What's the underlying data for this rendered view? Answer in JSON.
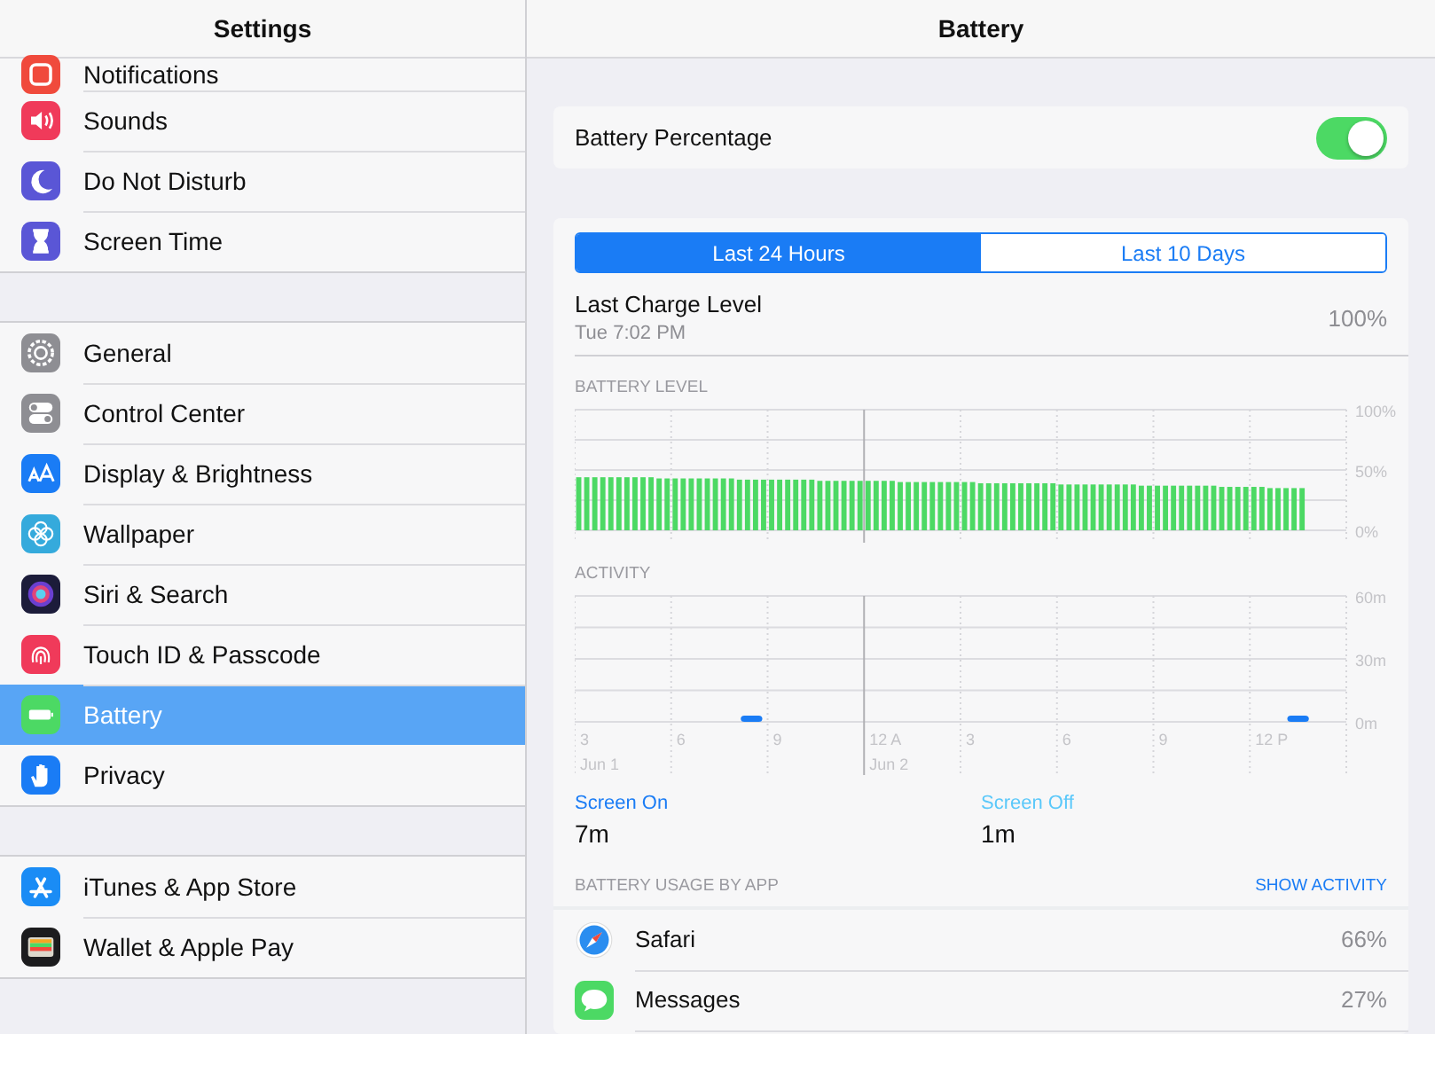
{
  "sidebar": {
    "title": "Settings",
    "groups": [
      {
        "items": [
          {
            "label": "Notifications",
            "selected": false
          },
          {
            "label": "Sounds",
            "selected": false
          },
          {
            "label": "Do Not Disturb",
            "selected": false
          },
          {
            "label": "Screen Time",
            "selected": false
          }
        ]
      },
      {
        "items": [
          {
            "label": "General",
            "selected": false
          },
          {
            "label": "Control Center",
            "selected": false
          },
          {
            "label": "Display & Brightness",
            "selected": false
          },
          {
            "label": "Wallpaper",
            "selected": false
          },
          {
            "label": "Siri & Search",
            "selected": false
          },
          {
            "label": "Touch ID & Passcode",
            "selected": false
          },
          {
            "label": "Battery",
            "selected": true
          },
          {
            "label": "Privacy",
            "selected": false
          }
        ]
      },
      {
        "items": [
          {
            "label": "iTunes & App Store",
            "selected": false
          },
          {
            "label": "Wallet & Apple Pay",
            "selected": false
          }
        ]
      }
    ]
  },
  "detail": {
    "title": "Battery",
    "percentage_row": {
      "label": "Battery Percentage",
      "on": true
    },
    "segments": [
      {
        "label": "Last 24 Hours",
        "selected": true
      },
      {
        "label": "Last 10 Days",
        "selected": false
      }
    ],
    "last_charge": {
      "label": "Last Charge Level",
      "time": "Tue 7:02 PM",
      "value": "100%"
    },
    "battery_level": {
      "label": "BATTERY LEVEL",
      "chart_data": {
        "type": "bar",
        "ylim": [
          0,
          100
        ],
        "yticks": [
          {
            "value": 0,
            "label": "0%"
          },
          {
            "value": 50,
            "label": "50%"
          },
          {
            "value": 100,
            "label": "100%"
          }
        ],
        "values": [
          44,
          44,
          44,
          44,
          44,
          44,
          44,
          44,
          44,
          44,
          43,
          43,
          43,
          43,
          43,
          43,
          43,
          43,
          43,
          43,
          42,
          42,
          42,
          42,
          42,
          42,
          42,
          42,
          42,
          42,
          41,
          41,
          41,
          41,
          41,
          41,
          41,
          41,
          41,
          41,
          40,
          40,
          40,
          40,
          40,
          40,
          40,
          40,
          40,
          40,
          39,
          39,
          39,
          39,
          39,
          39,
          39,
          39,
          39,
          39,
          38,
          38,
          38,
          38,
          38,
          38,
          38,
          38,
          38,
          38,
          37,
          37,
          37,
          37,
          37,
          37,
          37,
          37,
          37,
          37,
          36,
          36,
          36,
          36,
          36,
          36,
          35,
          35,
          35,
          35,
          35,
          null,
          null,
          null,
          null,
          null
        ]
      }
    },
    "activity": {
      "label": "ACTIVITY",
      "chart_data": {
        "type": "bar",
        "ylim": [
          0,
          60
        ],
        "yticks": [
          {
            "value": 0,
            "label": "0m"
          },
          {
            "value": 30,
            "label": "30m"
          },
          {
            "value": 60,
            "label": "60m"
          }
        ],
        "values": [
          0,
          0,
          0,
          0,
          0,
          3,
          0,
          0,
          0,
          0,
          0,
          0,
          0,
          0,
          0,
          0,
          0,
          0,
          0,
          0,
          0,
          0,
          3,
          0
        ]
      },
      "hour_labels": [
        "3",
        "6",
        "9",
        "12 A",
        "3",
        "6",
        "9",
        "12 P"
      ],
      "date_labels": [
        "Jun 1",
        "Jun 2"
      ]
    },
    "screen_on": {
      "label": "Screen On",
      "value": "7m"
    },
    "screen_off": {
      "label": "Screen Off",
      "value": "1m"
    },
    "usage": {
      "label": "BATTERY USAGE BY APP",
      "action": "SHOW ACTIVITY",
      "apps": [
        {
          "name": "Safari",
          "value": "66%"
        },
        {
          "name": "Messages",
          "value": "27%"
        }
      ]
    }
  }
}
